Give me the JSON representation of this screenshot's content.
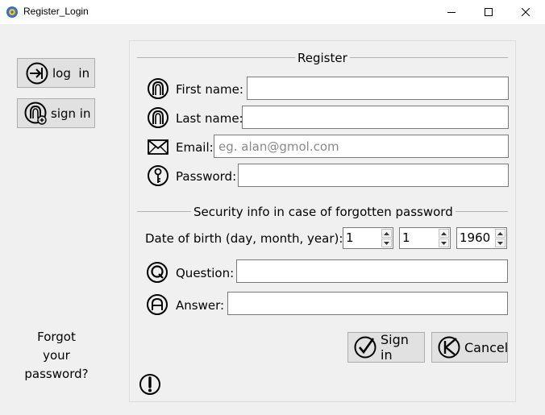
{
  "window": {
    "title": "Register_Login",
    "minimize_icon": "minimize-icon",
    "maximize_icon": "maximize-icon",
    "close_icon": "close-icon"
  },
  "sidebar": {
    "login_label": "log  in",
    "signin_label": "sign in",
    "forgot_line1": "Forgot",
    "forgot_line2": "your",
    "forgot_line3": "password?"
  },
  "register": {
    "section_title": "Register",
    "first_name_label": "First name:",
    "first_name_value": "",
    "last_name_label": "Last name:",
    "last_name_value": "",
    "email_label": "Email:",
    "email_placeholder": "eg. alan@gmol.com",
    "email_value": "",
    "password_label": "Password:",
    "password_value": ""
  },
  "security": {
    "section_title": "Security info in case of forgotten password",
    "dob_label": "Date of birth (day, month, year):",
    "dob_day": "1",
    "dob_month": "1",
    "dob_year": "1960",
    "question_label": "Question:",
    "question_value": "",
    "answer_label": "Answer:",
    "answer_value": ""
  },
  "actions": {
    "signin_label": "Sign in",
    "cancel_label": "Cancel"
  }
}
